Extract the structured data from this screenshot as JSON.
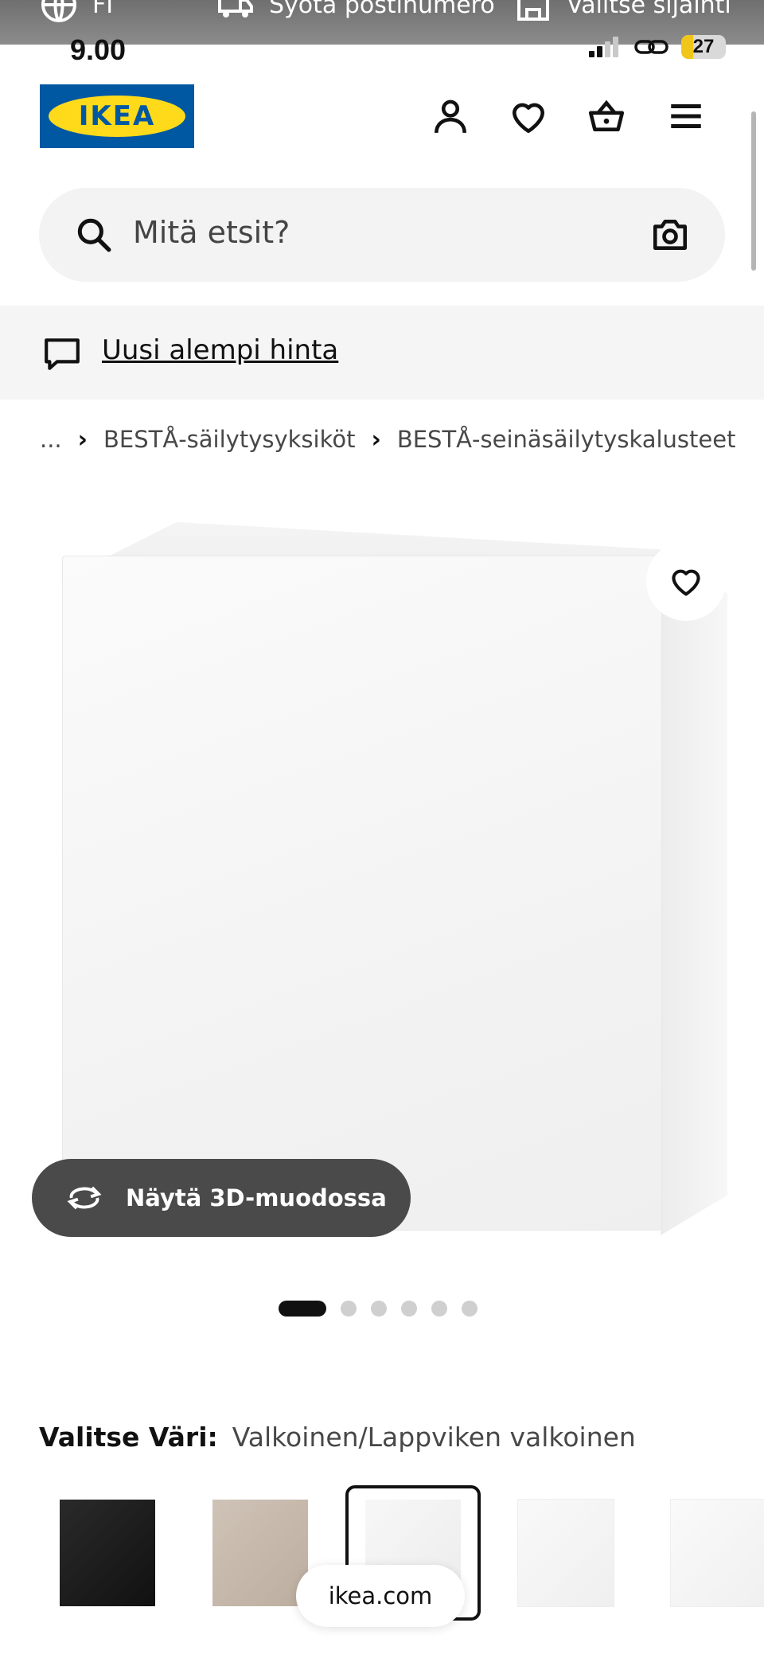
{
  "overlay": {
    "language_label": "FI",
    "postal_label": "Syötä postinumero",
    "location_label": "Valitse sijainti"
  },
  "status_bar": {
    "time": "9.00",
    "battery": "27",
    "battery_level": 0.27,
    "battery_color": "#f1c61b"
  },
  "header": {
    "logo_text": "IKEA",
    "brand_blue": "#0058a3",
    "brand_yellow": "#ffda1a",
    "icons": [
      "user-icon",
      "heart-icon",
      "basket-icon",
      "menu-icon"
    ]
  },
  "search": {
    "placeholder": "Mitä etsit?"
  },
  "announcement": {
    "text": "Uusi alempi hinta"
  },
  "breadcrumb": {
    "items": [
      "...",
      "BESTÅ-säilytysyksiköt",
      "BESTÅ-seinäsäilytyskalusteet"
    ]
  },
  "product": {
    "view_3d_label": "Näytä 3D-muodossa",
    "carousel_count": 6,
    "carousel_active": 1
  },
  "color_select": {
    "label": "Valitse Väri:",
    "value": "Valkoinen/Lappviken valkoinen",
    "swatches": [
      "#1e1e1e",
      "#c9bdb1",
      "#f2f2f2",
      "#f6f6f6",
      "#f8f8f8"
    ],
    "selected_index": 2
  },
  "browser": {
    "url": "ikea.com"
  }
}
